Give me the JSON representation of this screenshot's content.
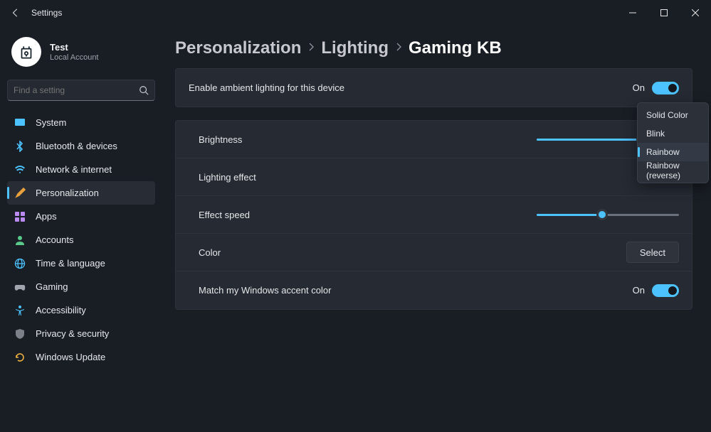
{
  "window": {
    "title": "Settings"
  },
  "profile": {
    "name": "Test",
    "subtitle": "Local Account"
  },
  "search": {
    "placeholder": "Find a setting"
  },
  "sidebar": {
    "items": [
      {
        "label": "System",
        "icon": "display"
      },
      {
        "label": "Bluetooth & devices",
        "icon": "bluetooth"
      },
      {
        "label": "Network & internet",
        "icon": "wifi"
      },
      {
        "label": "Personalization",
        "icon": "brush"
      },
      {
        "label": "Apps",
        "icon": "apps"
      },
      {
        "label": "Accounts",
        "icon": "person"
      },
      {
        "label": "Time & language",
        "icon": "globe"
      },
      {
        "label": "Gaming",
        "icon": "gamepad"
      },
      {
        "label": "Accessibility",
        "icon": "accessibility"
      },
      {
        "label": "Privacy & security",
        "icon": "shield"
      },
      {
        "label": "Windows Update",
        "icon": "update"
      }
    ],
    "active_index": 3
  },
  "breadcrumb": {
    "items": [
      "Personalization",
      "Lighting",
      "Gaming KB"
    ]
  },
  "ambient": {
    "label": "Enable ambient lighting for this device",
    "state_text": "On",
    "on": true
  },
  "rows": {
    "brightness": {
      "label": "Brightness",
      "value_pct": 74
    },
    "lighting_effect": {
      "label": "Lighting effect"
    },
    "effect_speed": {
      "label": "Effect speed",
      "value_pct": 46
    },
    "color": {
      "label": "Color",
      "button": "Select"
    },
    "match_accent": {
      "label": "Match my Windows accent color",
      "state_text": "On",
      "on": true
    }
  },
  "menu": {
    "items": [
      "Solid Color",
      "Blink",
      "Rainbow",
      "Rainbow (reverse)"
    ],
    "selected_index": 2
  },
  "colors": {
    "accent": "#4cc2ff"
  }
}
